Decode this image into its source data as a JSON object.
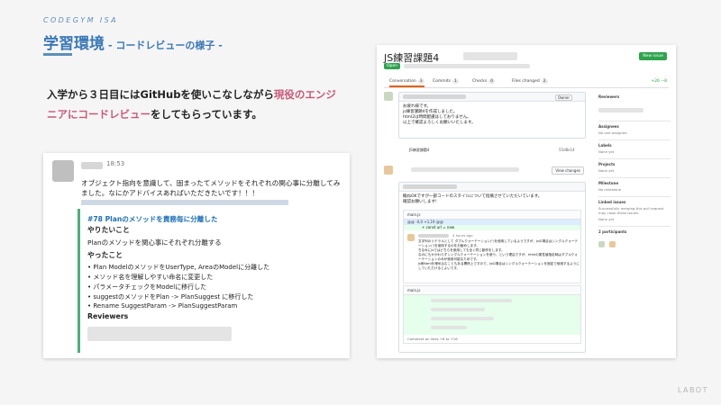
{
  "header": {
    "brand": "CODEGYM ISA",
    "title": "学習環境",
    "subtitle": "- コードレビューの様子 -"
  },
  "lead": {
    "part1": "入学から３日目にはGitHubを使いこなしながら",
    "highlight": "現役のエンジニアにコードレビュー",
    "part2": "をしてもらっています。"
  },
  "slack": {
    "time": "18:53",
    "message": "オブジェクト指向を意識して、固まったてメソッドをそれぞれの関心事に分離してみました。なにかアドバイスあればいただきたいです！！！",
    "quote": {
      "title": "#78 Planのメソッドを責務毎に分離した",
      "want_head": "やりたいこと",
      "want_text": "Planのメソッドを関心事にそれぞれ分離する",
      "done_head": "やったこと",
      "done_items": [
        "Plan ModelのメソッドをUserType, AreaのModelに分離した",
        "メソッド名を理解しやすい命名に変更した",
        "パラメータチェックをModelに移行した",
        "suggestのメソッドをPlan -> PlanSuggest に移行した",
        "Rename SuggestParam -> PlanSuggestParam"
      ],
      "reviewers_head": "Reviewers"
    }
  },
  "github": {
    "title": "JS練習課題4",
    "new_issue": "New issue",
    "open_badge": "Open",
    "tabs": [
      {
        "label": "Conversation",
        "count": "3"
      },
      {
        "label": "Commits",
        "count": "1"
      },
      {
        "label": "Checks",
        "count": "0"
      },
      {
        "label": "Files changed",
        "count": "2"
      }
    ],
    "diffstat": "+26 −8",
    "comment1": {
      "owner": "Owner",
      "lines": [
        "お疲れ様です。",
        "js練習課題4を作成しました。",
        "html2は時間配慮はしておりません。",
        "以上で確認よろしくお願いいたします。"
      ]
    },
    "commit": {
      "message": "JS練習課題4",
      "sha": "55d8e14"
    },
    "view_changes": "View changes",
    "review": {
      "lines": [
        "概ねOKですが一部コードのスタイルについて指摘させていただいています。",
        "確認お願いします!"
      ],
      "file": "main.js",
      "hunk": "@@ -0,0 +1,19 @@",
      "added_line": "+ const url = new",
      "reply_time": "4 hours ago",
      "reply_lines": [
        "文字列のリテラルとして ダブルクォーテーション(\")を使用しているようですが、jsの場合はシングルクォーテーション(')を使用するのをお勧めします。",
        "ちなみにjsではどちらを使用しても全く同じ動作をします。",
        "なのにもかかわらずシングルクォーテーションを使う、という理由ですが、htmlの属性値指定時はダブルクォーテーションのみが使用可能なためです。",
        "js側htmlを埋め込むこともある関係上ですので、jsの場合はシングルクォーテーションを固定で使用するようにしていただけるとよいです。"
      ],
      "file2": "main.js",
      "comment_on": "Comment on lines +8 to +16"
    },
    "sidebar": [
      {
        "label": "Reviewers",
        "value": ""
      },
      {
        "label": "Assignees",
        "value": "No one assigned"
      },
      {
        "label": "Labels",
        "value": "None yet"
      },
      {
        "label": "Projects",
        "value": "None yet"
      },
      {
        "label": "Milestone",
        "value": "No milestone"
      },
      {
        "label": "Linked issues",
        "value": "Successfully merging this pull request may close these issues."
      },
      {
        "label": "None yet",
        "value": ""
      },
      {
        "label": "2 participants",
        "value": ""
      }
    ]
  },
  "footer": {
    "logo": "LABOT"
  },
  "colors": {
    "title_blue": "#3a78b8",
    "highlight_pink": "#c85a78",
    "slack_green": "#4caf7a",
    "github_green": "#2ea44f"
  }
}
